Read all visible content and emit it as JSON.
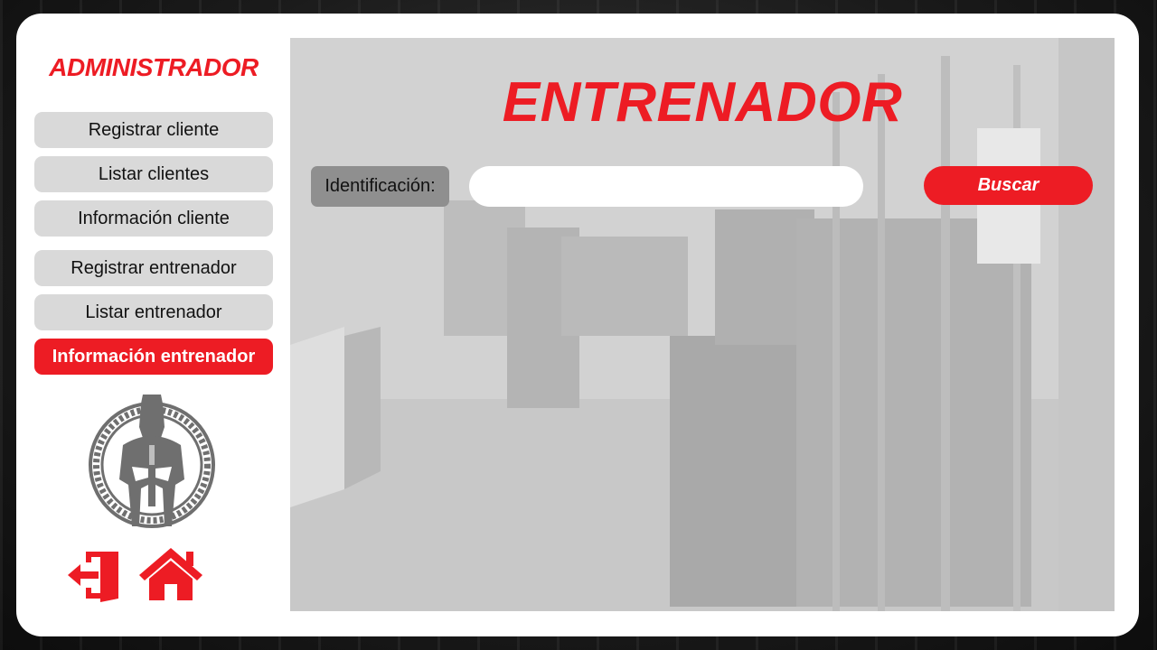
{
  "sidebar": {
    "title": "ADMINISTRADOR",
    "nav": [
      {
        "label": "Registrar cliente"
      },
      {
        "label": "Listar clientes"
      },
      {
        "label": "Información cliente"
      },
      {
        "label": "Registrar entrenador"
      },
      {
        "label": "Listar entrenador"
      },
      {
        "label": "Información entrenador",
        "active": true
      }
    ],
    "icons": {
      "logo": "spartan-helmet-logo",
      "logout": "logout-icon",
      "home": "home-icon"
    }
  },
  "main": {
    "title": "ENTRENADOR",
    "search": {
      "label": "Identificación:",
      "value": "",
      "placeholder": "",
      "button_label": "Buscar"
    }
  },
  "colors": {
    "accent": "#ed1c24",
    "nav_bg": "#d9d9d9",
    "label_bg": "#8f8f8f",
    "logo_gray": "#6f6f6f"
  }
}
